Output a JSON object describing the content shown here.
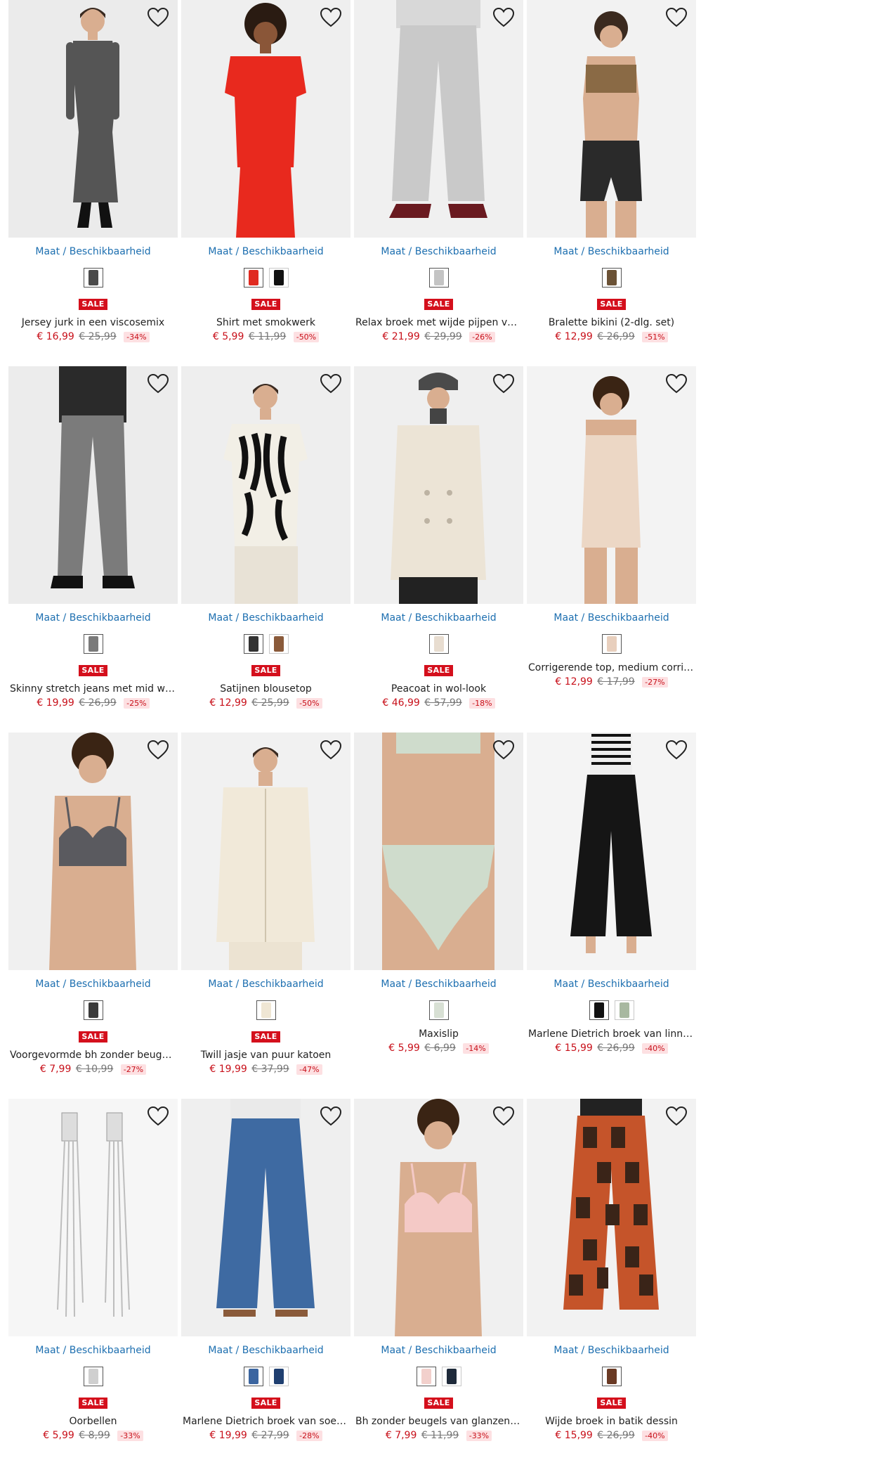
{
  "maat_label": "Maat / Beschikbaarheid",
  "sale_label": "SALE",
  "products": [
    {
      "name": "Jersey jurk in een viscosemix",
      "price": "€ 16,99",
      "old": "€ 25,99",
      "pct": "-34%",
      "sale": true,
      "bg": "#ebebeb",
      "garment": "dress",
      "colors": [
        "#555555"
      ],
      "swatches": [
        "#4a4a4a"
      ]
    },
    {
      "name": "Shirt met smokwerk",
      "price": "€ 5,99",
      "old": "€ 11,99",
      "pct": "-50%",
      "sale": true,
      "bg": "#efefef",
      "garment": "top",
      "colors": [
        "#e8291e",
        "#e8291e"
      ],
      "swatches": [
        "#e02a20",
        "#111111"
      ]
    },
    {
      "name": "Relax broek met wijde pijpen van vi...",
      "price": "€ 21,99",
      "old": "€ 29,99",
      "pct": "-26%",
      "sale": true,
      "bg": "#f0f0f0",
      "garment": "pants",
      "colors": [
        "#c9c9c9"
      ],
      "swatches": [
        "#c4c4c4"
      ]
    },
    {
      "name": "Bralette bikini (2-dlg. set)",
      "price": "€ 12,99",
      "old": "€ 26,99",
      "pct": "-51%",
      "sale": true,
      "bg": "#f2f2f2",
      "garment": "bikini",
      "colors": [
        "#8a6a45",
        "#2a2a2a"
      ],
      "swatches": [
        "#6b5236"
      ]
    },
    {
      "name": "Skinny stretch jeans met mid waist",
      "price": "€ 19,99",
      "old": "€ 26,99",
      "pct": "-25%",
      "sale": true,
      "bg": "#ececec",
      "garment": "jeans",
      "colors": [
        "#7b7b7b"
      ],
      "swatches": [
        "#7a7a7a"
      ]
    },
    {
      "name": "Satijnen blousetop",
      "price": "€ 12,99",
      "old": "€ 25,99",
      "pct": "-50%",
      "sale": true,
      "bg": "#eeeeee",
      "garment": "blouse",
      "colors": [
        "#f2efe6"
      ],
      "swatches": [
        "#333333",
        "#8a5a3a"
      ]
    },
    {
      "name": "Peacoat in wol-look",
      "price": "€ 46,99",
      "old": "€ 57,99",
      "pct": "-18%",
      "sale": true,
      "bg": "#efefef",
      "garment": "coat",
      "colors": [
        "#ece4d6"
      ],
      "swatches": [
        "#e8ddd0"
      ]
    },
    {
      "name": "Corrigerende top, medium corriger...",
      "price": "€ 12,99",
      "old": "€ 17,99",
      "pct": "-27%",
      "sale": false,
      "bg": "#f3f3f3",
      "garment": "shaper",
      "colors": [
        "#ecd7c5"
      ],
      "swatches": [
        "#e8cfbd"
      ]
    },
    {
      "name": "Voorgevormde bh zonder beugels ...",
      "price": "€ 7,99",
      "old": "€ 10,99",
      "pct": "-27%",
      "sale": true,
      "bg": "#f0f0f0",
      "garment": "bra",
      "colors": [
        "#5a5a5f"
      ],
      "swatches": [
        "#3a3a3a"
      ]
    },
    {
      "name": "Twill jasje van puur katoen",
      "price": "€ 19,99",
      "old": "€ 37,99",
      "pct": "-47%",
      "sale": true,
      "bg": "#f1f1f1",
      "garment": "jacket",
      "colors": [
        "#f1e9d9"
      ],
      "swatches": [
        "#efe6d4"
      ]
    },
    {
      "name": "Maxislip",
      "price": "€ 5,99",
      "old": "€ 6,99",
      "pct": "-14%",
      "sale": false,
      "bg": "#eeeeee",
      "garment": "brief",
      "colors": [
        "#cfdccc"
      ],
      "swatches": [
        "#d8e0d4"
      ]
    },
    {
      "name": "Marlene Dietrich broek van linnen",
      "price": "€ 15,99",
      "old": "€ 26,99",
      "pct": "-40%",
      "sale": false,
      "bg": "#f4f4f4",
      "garment": "widepants",
      "colors": [
        "#151515"
      ],
      "swatches": [
        "#111111",
        "#a8b8a0"
      ]
    },
    {
      "name": "Oorbellen",
      "price": "€ 5,99",
      "old": "€ 8,99",
      "pct": "-33%",
      "sale": true,
      "bg": "#f6f6f6",
      "garment": "earrings",
      "colors": [
        "#bdbdbd"
      ],
      "swatches": [
        "#cfcfcf"
      ]
    },
    {
      "name": "Marlene Dietrich broek van soepelv...",
      "price": "€ 19,99",
      "old": "€ 27,99",
      "pct": "-28%",
      "sale": true,
      "bg": "#efefef",
      "garment": "denimwide",
      "colors": [
        "#3e6aa2"
      ],
      "swatches": [
        "#3b65a0",
        "#1f3f70"
      ]
    },
    {
      "name": "Bh zonder beugels van glanzend ma...",
      "price": "€ 7,99",
      "old": "€ 11,99",
      "pct": "-33%",
      "sale": true,
      "bg": "#f0f0f0",
      "garment": "bra",
      "colors": [
        "#f4c9c6"
      ],
      "swatches": [
        "#f2d0cc",
        "#1e2a3a"
      ]
    },
    {
      "name": "Wijde broek in batik dessin",
      "price": "€ 15,99",
      "old": "€ 26,99",
      "pct": "-40%",
      "sale": true,
      "bg": "#f2f2f2",
      "garment": "batik",
      "colors": [
        "#3a2418",
        "#c5542a"
      ],
      "swatches": [
        "#6a3a24"
      ]
    }
  ]
}
